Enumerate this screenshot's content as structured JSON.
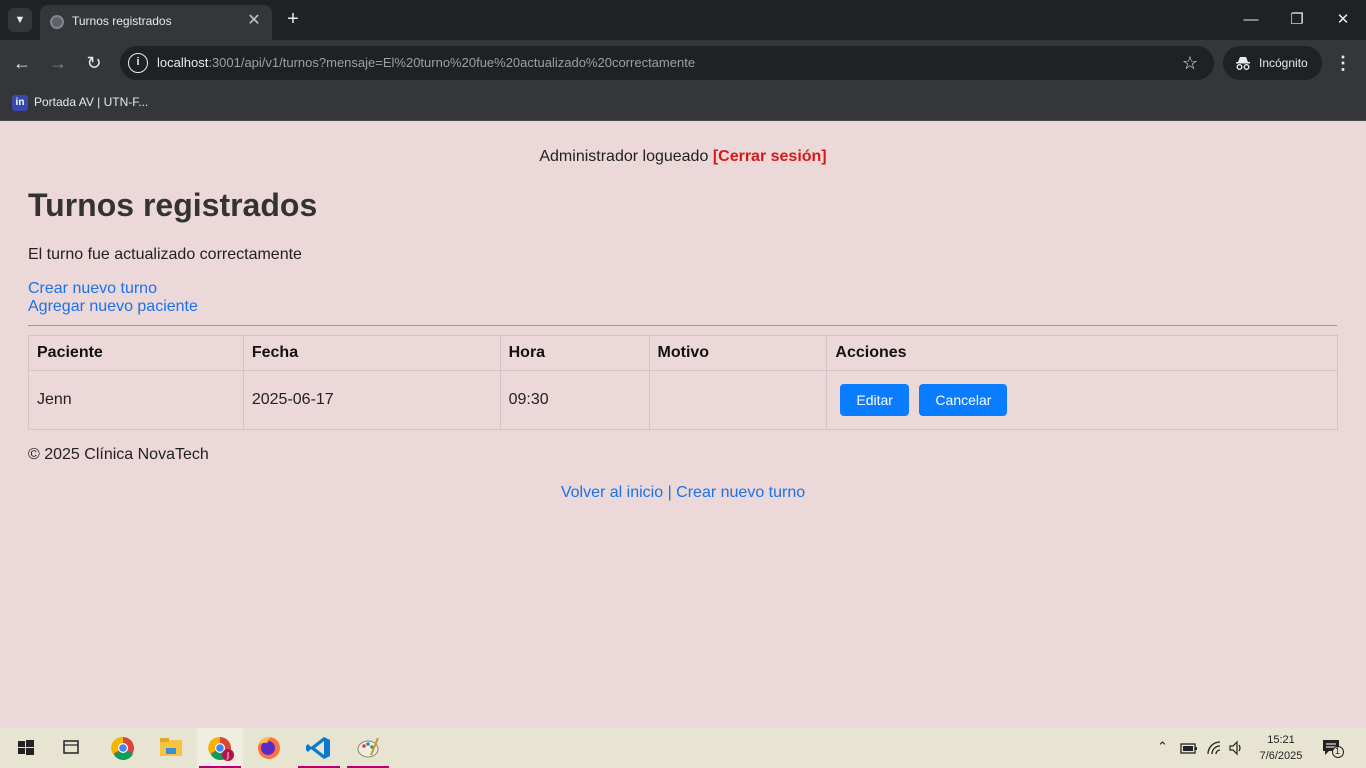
{
  "browser": {
    "tab_title": "Turnos registrados",
    "url_host": "localhost",
    "url_path": ":3001/api/v1/turnos?mensaje=El%20turno%20fue%20actualizado%20correctamente",
    "incognito_label": "Incógnito",
    "bookmark_label": "Portada AV | UTN-F...",
    "bookmark_icon": "in"
  },
  "page": {
    "admin_status": "Administrador logueado",
    "logout_link": "[Cerrar sesión]",
    "title": "Turnos registrados",
    "message": "El turno fue actualizado correctamente",
    "links": {
      "create_turn": "Crear nuevo turno",
      "add_patient": "Agregar nuevo paciente"
    },
    "table": {
      "headers": [
        "Paciente",
        "Fecha",
        "Hora",
        "Motivo",
        "Acciones"
      ],
      "rows": [
        {
          "paciente": "Jenn",
          "fecha": "2025-06-17",
          "hora": "09:30",
          "motivo": "",
          "edit_label": "Editar",
          "cancel_label": "Cancelar"
        }
      ]
    },
    "footer": "© 2025 Clínica NovaTech",
    "bottom_links": {
      "home": "Volver al inicio",
      "separator": " | ",
      "create_turn": "Crear nuevo turno"
    }
  },
  "taskbar": {
    "time": "15:21",
    "date": "7/6/2025",
    "notification_count": "1",
    "apps": [
      "start-icon",
      "task-view-icon",
      "chrome-icon",
      "file-explorer-icon",
      "chrome-profile-icon",
      "firefox-icon",
      "vscode-icon",
      "paint-icon"
    ]
  },
  "colors": {
    "page_bg": "#ecd7d9",
    "link": "#1a73e8",
    "logout": "#d61a1a",
    "button": "#0a7cff"
  }
}
